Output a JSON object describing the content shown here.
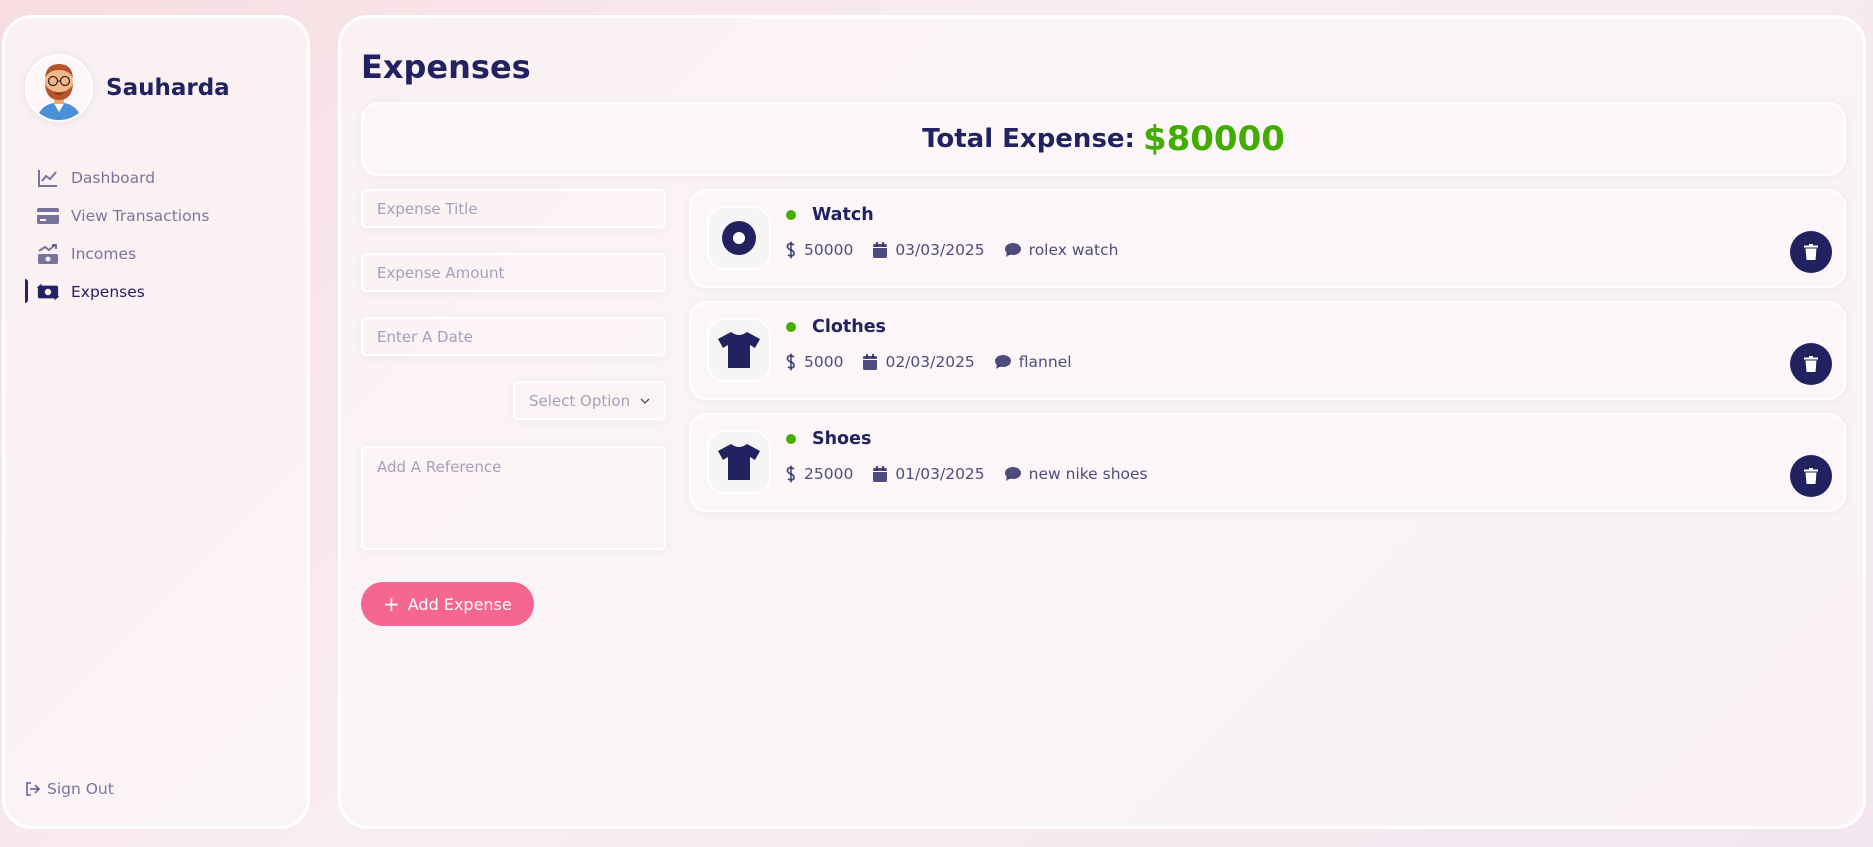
{
  "user": {
    "name": "Sauharda"
  },
  "nav": {
    "items": [
      {
        "label": "Dashboard",
        "icon": "chart-line-icon",
        "active": false
      },
      {
        "label": "View Transactions",
        "icon": "credit-card-icon",
        "active": false
      },
      {
        "label": "Incomes",
        "icon": "money-bill-trend-up-icon",
        "active": false
      },
      {
        "label": "Expenses",
        "icon": "money-bill-transfer-icon",
        "active": true
      }
    ],
    "signout_label": "Sign Out"
  },
  "page": {
    "title": "Expenses",
    "total_label": "Total Expense:",
    "total_value": "$80000"
  },
  "form": {
    "title_placeholder": "Expense Title",
    "amount_placeholder": "Expense Amount",
    "date_placeholder": "Enter A Date",
    "select_placeholder": "Select Option",
    "reference_placeholder": "Add A Reference",
    "add_button_label": "Add Expense"
  },
  "expenses": [
    {
      "title": "Watch",
      "amount": "50000",
      "date": "03/03/2025",
      "description": "rolex watch",
      "icon": "circle-dot-icon"
    },
    {
      "title": "Clothes",
      "amount": "5000",
      "date": "02/03/2025",
      "description": "flannel",
      "icon": "shirt-icon"
    },
    {
      "title": "Shoes",
      "amount": "25000",
      "date": "01/03/2025",
      "description": "new nike shoes",
      "icon": "shirt-icon"
    }
  ],
  "colors": {
    "primary": "#222260",
    "accent_green": "#42AD00",
    "accent_pink": "#F56692"
  }
}
